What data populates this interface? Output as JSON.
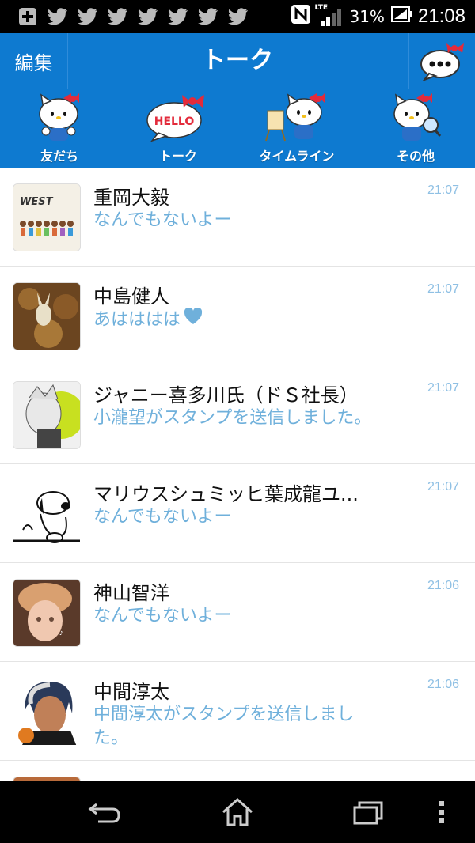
{
  "status_bar": {
    "left_icons": [
      "add-icon",
      "twitter-icon",
      "twitter-icon",
      "twitter-icon",
      "twitter-icon",
      "twitter-icon",
      "twitter-icon",
      "twitter-icon"
    ],
    "network": "LTE",
    "battery": "31%",
    "time": "21:08"
  },
  "header": {
    "edit_label": "編集",
    "title": "トーク"
  },
  "tabs": [
    {
      "label": "友だち"
    },
    {
      "label": "トーク"
    },
    {
      "label": "タイムライン"
    },
    {
      "label": "その他"
    }
  ],
  "chats": [
    {
      "name": "重岡大毅",
      "message": "なんでもないよー",
      "time": "21:07"
    },
    {
      "name": "中島健人",
      "message": "あはははは",
      "time": "21:07"
    },
    {
      "name": "ジャニー喜多川氏（ドＳ社長）",
      "message": "小瀧望がスタンプを送信しました。",
      "time": "21:07"
    },
    {
      "name": "マリウスシュミッヒ葉成龍ユ...",
      "message": "なんでもないよー",
      "time": "21:07"
    },
    {
      "name": "神山智洋",
      "message": "なんでもないよー",
      "time": "21:06"
    },
    {
      "name": "中間淳太",
      "message": "中間淳太がスタンプを送信しました。",
      "time": "21:06"
    }
  ],
  "colors": {
    "header_blue": "#0e7ad0",
    "message_blue": "#6fb0db",
    "time_blue": "#8fc0e4"
  }
}
